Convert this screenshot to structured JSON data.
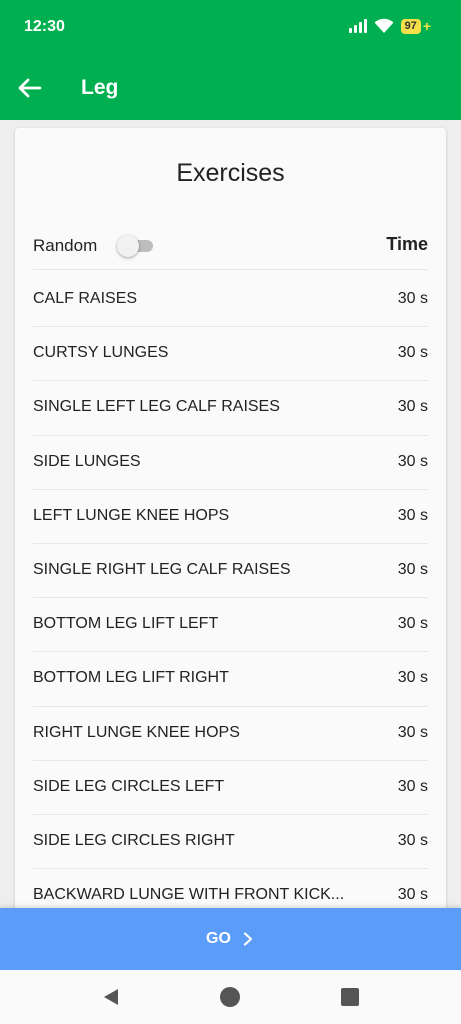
{
  "status_bar": {
    "time": "12:30",
    "battery": "97",
    "battery_charging": "+"
  },
  "app_bar": {
    "title": "Leg",
    "back_icon": "arrow-left-icon"
  },
  "card": {
    "title": "Exercises",
    "random_label": "Random",
    "random_enabled": false,
    "time_header": "Time"
  },
  "exercises": [
    {
      "name": "CALF RAISES",
      "time": "30 s"
    },
    {
      "name": "CURTSY LUNGES",
      "time": "30 s"
    },
    {
      "name": "SINGLE LEFT LEG CALF RAISES",
      "time": "30 s"
    },
    {
      "name": "SIDE LUNGES",
      "time": "30 s"
    },
    {
      "name": "LEFT LUNGE KNEE HOPS",
      "time": "30 s"
    },
    {
      "name": "SINGLE RIGHT LEG CALF RAISES",
      "time": "30 s"
    },
    {
      "name": "BOTTOM LEG LIFT LEFT",
      "time": "30 s"
    },
    {
      "name": "BOTTOM LEG LIFT RIGHT",
      "time": "30 s"
    },
    {
      "name": "RIGHT LUNGE KNEE HOPS",
      "time": "30 s"
    },
    {
      "name": "SIDE LEG CIRCLES LEFT",
      "time": "30 s"
    },
    {
      "name": "SIDE LEG CIRCLES RIGHT",
      "time": "30 s"
    },
    {
      "name": "BACKWARD LUNGE WITH FRONT KICK...",
      "time": "30 s"
    }
  ],
  "go_button": {
    "label": "GO"
  },
  "colors": {
    "primary": "#00b050",
    "go_button": "#5b9cf8",
    "battery": "#f5e04a"
  }
}
